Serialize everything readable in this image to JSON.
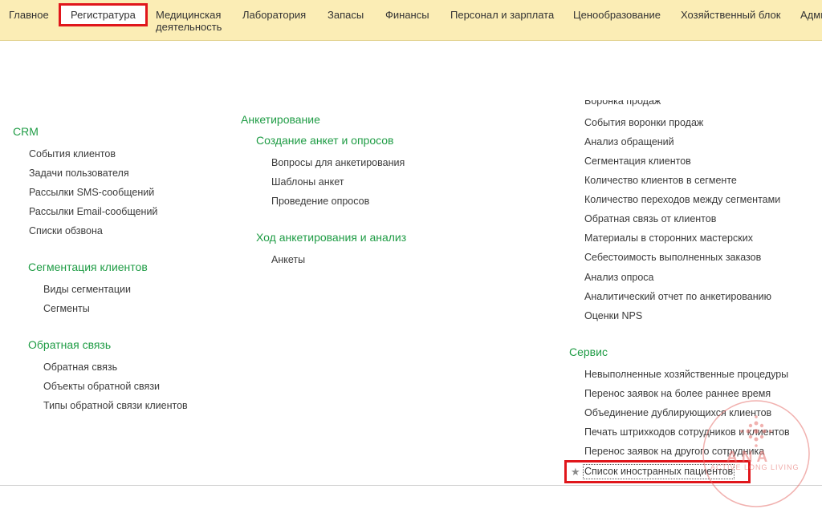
{
  "nav": {
    "tabs": [
      {
        "label": "Главное"
      },
      {
        "label": "Регистратура"
      },
      {
        "label_line1": "Медицинская",
        "label_line2": "деятельность"
      },
      {
        "label": "Лаборатория"
      },
      {
        "label": "Запасы"
      },
      {
        "label": "Финансы"
      },
      {
        "label": "Персонал и зарплата"
      },
      {
        "label": "Ценообразование"
      },
      {
        "label": "Хозяйственный блок"
      },
      {
        "label": "Адми"
      }
    ],
    "active_tab": "Регистратура"
  },
  "left": {
    "crm": {
      "title": "CRM",
      "items": [
        "События клиентов",
        "Задачи пользователя",
        "Рассылки SMS-сообщений",
        "Рассылки Email-сообщений",
        "Списки обзвона"
      ]
    },
    "segmentation": {
      "title": "Сегментация клиентов",
      "items": [
        "Виды сегментации",
        "Сегменты"
      ]
    },
    "feedback": {
      "title": "Обратная связь",
      "items": [
        "Обратная связь",
        "Объекты обратной связи",
        "Типы обратной связи клиентов"
      ]
    }
  },
  "middle": {
    "title": "Анкетирование",
    "create": {
      "title": "Создание анкет и опросов",
      "items": [
        "Вопросы для анкетирования",
        "Шаблоны анкет",
        "Проведение опросов"
      ]
    },
    "progress": {
      "title": "Ход анкетирования и анализ",
      "items": [
        "Анкеты"
      ]
    }
  },
  "right": {
    "cut_item": "Воронка продаж",
    "reports": [
      "События воронки продаж",
      "Анализ обращений",
      "Сегментация клиентов",
      "Количество клиентов в сегменте",
      "Количество переходов между сегментами",
      "Обратная связь от клиентов",
      "Материалы в сторонних мастерских",
      "Себестоимость выполненных заказов",
      "Анализ опроса",
      "Аналитический отчет по анкетированию",
      "Оценки NPS"
    ],
    "service": {
      "title": "Сервис",
      "items": [
        "Невыполненные хозяйственные процедуры",
        "Перенос заявок на более раннее время",
        "Объединение дублирующихся клиентов",
        "Печать штрихкодов сотрудников и клиентов",
        "Перенос заявок на другого сотрудника",
        "Список иностранных пациентов"
      ]
    }
  },
  "watermark": {
    "brand": "ANA",
    "slogan": "ACTIVE LONG LIVING"
  },
  "colors": {
    "nav_bg": "#fbedb5",
    "group_title": "#1f9c45",
    "highlight": "#e0161b",
    "link": "#3a3a3a"
  }
}
